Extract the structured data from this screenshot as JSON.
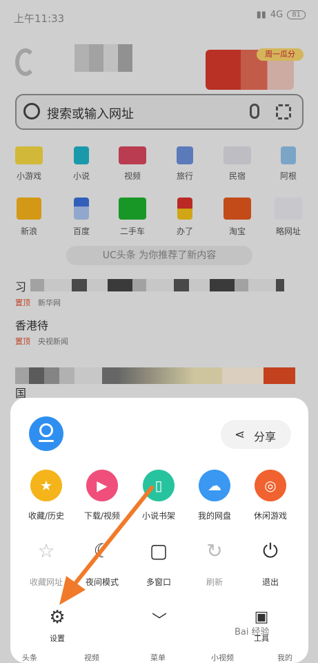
{
  "status": {
    "time": "上午11:33",
    "network": "4G",
    "battery": "81"
  },
  "search": {
    "placeholder": "搜索或输入网址"
  },
  "promo_badge": "周一瓜分",
  "shortcuts": [
    {
      "label": "小游戏"
    },
    {
      "label": "小说"
    },
    {
      "label": "视频"
    },
    {
      "label": "旅行"
    },
    {
      "label": "民宿"
    },
    {
      "label": "阿根"
    },
    {
      "label": "新浪"
    },
    {
      "label": "百度"
    },
    {
      "label": "二手车"
    },
    {
      "label": "办了"
    },
    {
      "label": "淘宝"
    },
    {
      "label": "略网址"
    }
  ],
  "feed": {
    "banner": "UC头条 为你推荐了新内容",
    "headline1": "习",
    "headline1_tag": "置顶",
    "headline1_source": "新华网",
    "headline2": "香港待",
    "headline2_tag": "置顶",
    "headline2_source": "央视新闻",
    "headline3": "国"
  },
  "menu": {
    "share_label": "分享",
    "row1": [
      {
        "label": "收藏/历史",
        "color": "#f4b41a"
      },
      {
        "label": "下载/视频",
        "color": "#ef4f7a"
      },
      {
        "label": "小说书架",
        "color": "#27c39e"
      },
      {
        "label": "我的网盘",
        "color": "#3a97f2"
      },
      {
        "label": "休闲游戏",
        "color": "#f0622f"
      }
    ],
    "row2": [
      {
        "label": "收藏网址",
        "enabled": false
      },
      {
        "label": "夜间模式",
        "enabled": true
      },
      {
        "label": "多窗口",
        "enabled": true
      },
      {
        "label": "刷新",
        "enabled": false
      },
      {
        "label": "退出",
        "enabled": true
      }
    ],
    "settings_label": "设置",
    "toolbox_label": "工具"
  },
  "bottom_nav": [
    "头条",
    "视频",
    "菜单",
    "小视频",
    "我的"
  ],
  "watermark": "Bai 经验",
  "accent_color": "#f07a2a"
}
